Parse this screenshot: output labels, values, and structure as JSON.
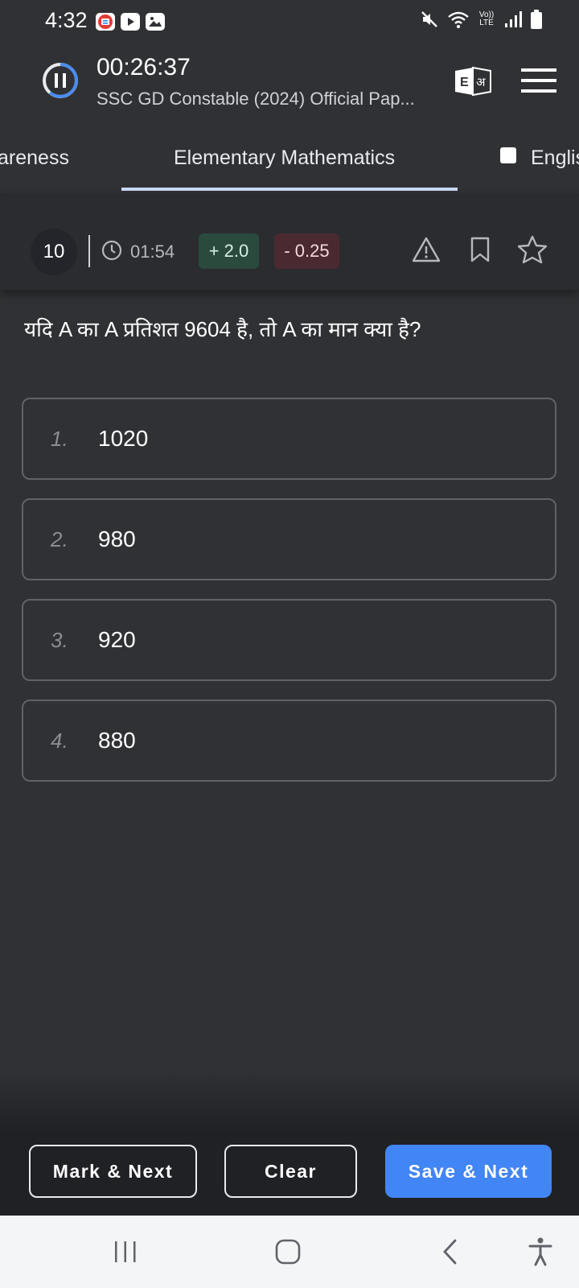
{
  "status_bar": {
    "time": "4:32",
    "network_label": "Vo)) LTE",
    "icons": [
      "app-notification-icon",
      "youtube-icon",
      "gallery-icon",
      "mute-icon",
      "wifi-icon",
      "signal-icon",
      "battery-icon"
    ]
  },
  "header": {
    "timer": "00:26:37",
    "test_title": "SSC GD Constable (2024) Official Pap...",
    "lang_icon_letters": [
      "E",
      "अ"
    ]
  },
  "tabs": {
    "items": [
      {
        "label": "areness",
        "active": false
      },
      {
        "label": "Elementary Mathematics",
        "active": true
      },
      {
        "label": "Englis",
        "active": false
      }
    ]
  },
  "question_bar": {
    "number": "10",
    "time_spent": "01:54",
    "positive_marks": "+ 2.0",
    "negative_marks": "- 0.25"
  },
  "question": {
    "text": "यदि A का A प्रतिशत 9604 है, तो A का मान क्या है?"
  },
  "options": [
    {
      "index": "1.",
      "value": "1020"
    },
    {
      "index": "2.",
      "value": "980"
    },
    {
      "index": "3.",
      "value": "920"
    },
    {
      "index": "4.",
      "value": "880"
    }
  ],
  "footer": {
    "mark_next": "Mark & Next",
    "clear": "Clear",
    "save_next": "Save & Next"
  },
  "colors": {
    "background": "#303134",
    "accent": "#4285f4",
    "positive_badge": "#2a4a3d",
    "negative_badge": "#4a2a30"
  }
}
